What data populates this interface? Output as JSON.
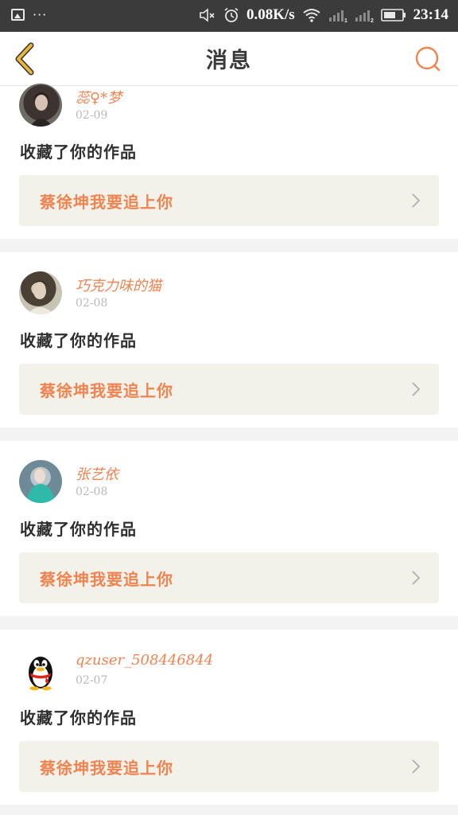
{
  "statusbar": {
    "dots": "···",
    "net_speed": "0.08K/s",
    "sim1": "1",
    "sim2": "2",
    "time": "23:14",
    "icons": [
      "image-icon",
      "mute-icon",
      "alarm-icon",
      "wifi-icon",
      "signal-icon",
      "battery-icon"
    ]
  },
  "header": {
    "title": "消息",
    "back_icon": "chevron-left-icon",
    "search_icon": "search-icon"
  },
  "colors": {
    "accent": "#f0834f",
    "back_icon": "#e9b63c",
    "work_bg": "#f2f2ea"
  },
  "messages": [
    {
      "username": "蕊♀*梦",
      "date": "02-09",
      "action": "收藏了你的作品",
      "work_title": "蔡徐坤我要追上你"
    },
    {
      "username": "巧克力味的猫",
      "date": "02-08",
      "action": "收藏了你的作品",
      "work_title": "蔡徐坤我要追上你"
    },
    {
      "username": "张艺依",
      "date": "02-08",
      "action": "收藏了你的作品",
      "work_title": "蔡徐坤我要追上你"
    },
    {
      "username": "qzuser_508446844",
      "date": "02-07",
      "action": "收藏了你的作品",
      "work_title": "蔡徐坤我要追上你"
    }
  ]
}
